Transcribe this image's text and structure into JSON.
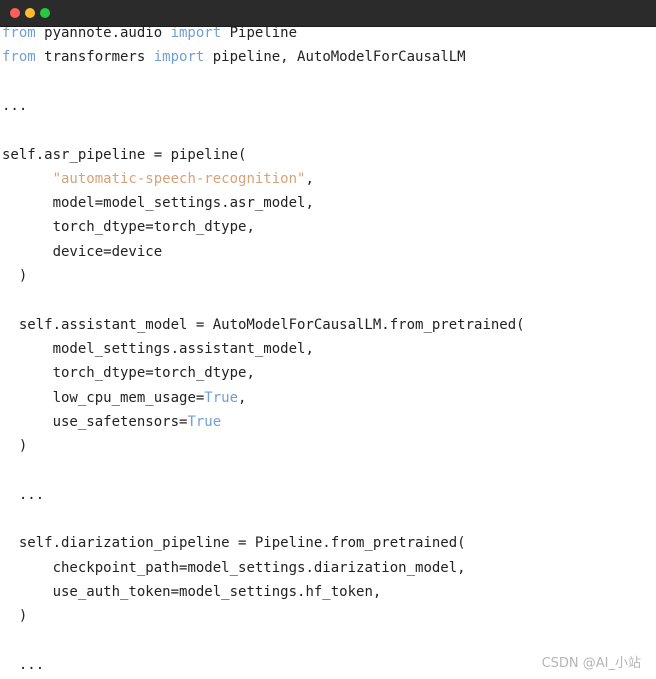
{
  "window": {
    "controls": {
      "close_color": "#ff5f56",
      "minimize_color": "#ffbd2e",
      "maximize_color": "#27c93f"
    }
  },
  "code": {
    "lines": [
      {
        "indent": "",
        "parts": [
          {
            "t": "from",
            "c": "kw"
          },
          {
            "t": " pyannote.audio ",
            "c": ""
          },
          {
            "t": "import",
            "c": "kw"
          },
          {
            "t": " Pipeline",
            "c": ""
          }
        ]
      },
      {
        "indent": "",
        "parts": [
          {
            "t": "from",
            "c": "kw"
          },
          {
            "t": " transformers ",
            "c": ""
          },
          {
            "t": "import",
            "c": "kw"
          },
          {
            "t": " pipeline, AutoModelForCausalLM",
            "c": ""
          }
        ]
      },
      {
        "indent": "",
        "parts": []
      },
      {
        "indent": "",
        "parts": [
          {
            "t": "...",
            "c": ""
          }
        ]
      },
      {
        "indent": "",
        "parts": []
      },
      {
        "indent": "",
        "parts": [
          {
            "t": "self.asr_pipeline = pipeline(",
            "c": ""
          }
        ]
      },
      {
        "indent": "      ",
        "parts": [
          {
            "t": "\"automatic-speech-recognition\"",
            "c": "str"
          },
          {
            "t": ",",
            "c": ""
          }
        ]
      },
      {
        "indent": "      ",
        "parts": [
          {
            "t": "model=model_settings.asr_model,",
            "c": ""
          }
        ]
      },
      {
        "indent": "      ",
        "parts": [
          {
            "t": "torch_dtype=torch_dtype,",
            "c": ""
          }
        ]
      },
      {
        "indent": "      ",
        "parts": [
          {
            "t": "device=device",
            "c": ""
          }
        ]
      },
      {
        "indent": "  ",
        "parts": [
          {
            "t": ")",
            "c": ""
          }
        ]
      },
      {
        "indent": "",
        "parts": []
      },
      {
        "indent": "  ",
        "parts": [
          {
            "t": "self.assistant_model = AutoModelForCausalLM.from_pretrained(",
            "c": ""
          }
        ]
      },
      {
        "indent": "      ",
        "parts": [
          {
            "t": "model_settings.assistant_model,",
            "c": ""
          }
        ]
      },
      {
        "indent": "      ",
        "parts": [
          {
            "t": "torch_dtype=torch_dtype,",
            "c": ""
          }
        ]
      },
      {
        "indent": "      ",
        "parts": [
          {
            "t": "low_cpu_mem_usage=",
            "c": ""
          },
          {
            "t": "True",
            "c": "bool"
          },
          {
            "t": ",",
            "c": ""
          }
        ]
      },
      {
        "indent": "      ",
        "parts": [
          {
            "t": "use_safetensors=",
            "c": ""
          },
          {
            "t": "True",
            "c": "bool"
          }
        ]
      },
      {
        "indent": "  ",
        "parts": [
          {
            "t": ")",
            "c": ""
          }
        ]
      },
      {
        "indent": "",
        "parts": []
      },
      {
        "indent": "  ",
        "parts": [
          {
            "t": "...",
            "c": ""
          }
        ]
      },
      {
        "indent": "",
        "parts": []
      },
      {
        "indent": "  ",
        "parts": [
          {
            "t": "self.diarization_pipeline = Pipeline.from_pretrained(",
            "c": ""
          }
        ]
      },
      {
        "indent": "      ",
        "parts": [
          {
            "t": "checkpoint_path=model_settings.diarization_model,",
            "c": ""
          }
        ]
      },
      {
        "indent": "      ",
        "parts": [
          {
            "t": "use_auth_token=model_settings.hf_token,",
            "c": ""
          }
        ]
      },
      {
        "indent": "  ",
        "parts": [
          {
            "t": ")",
            "c": ""
          }
        ]
      },
      {
        "indent": "",
        "parts": []
      },
      {
        "indent": "  ",
        "parts": [
          {
            "t": "...",
            "c": ""
          }
        ]
      }
    ],
    "colors": {
      "keyword": "#6f9fd8",
      "string": "#d6a27a",
      "text": "#222222"
    }
  },
  "watermark": {
    "text": "CSDN @AI_小站"
  }
}
